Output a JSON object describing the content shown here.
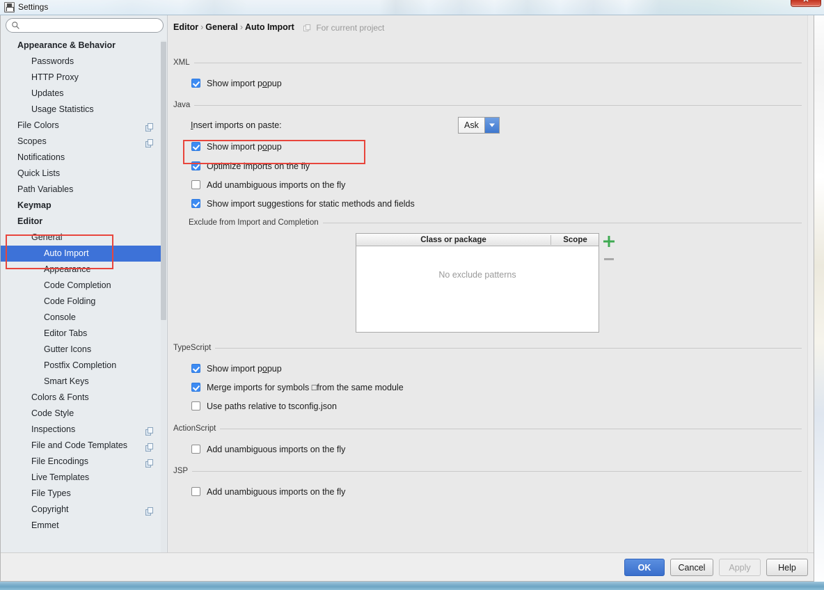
{
  "window": {
    "title": "Settings",
    "icon": "save-disk-icon",
    "close_label": "✕"
  },
  "sidebar": {
    "search": {
      "value": "",
      "placeholder": "",
      "icon": "search-icon"
    },
    "items": [
      {
        "label": "Appearance & Behavior",
        "level": 0,
        "bold": true,
        "arrow": "none",
        "copy": false,
        "selected": false
      },
      {
        "label": "Passwords",
        "level": 1,
        "bold": false,
        "arrow": "none",
        "copy": false,
        "selected": false
      },
      {
        "label": "HTTP Proxy",
        "level": 1,
        "bold": false,
        "arrow": "none",
        "copy": false,
        "selected": false
      },
      {
        "label": "Updates",
        "level": 1,
        "bold": false,
        "arrow": "none",
        "copy": false,
        "selected": false
      },
      {
        "label": "Usage Statistics",
        "level": 1,
        "bold": false,
        "arrow": "none",
        "copy": false,
        "selected": false
      },
      {
        "label": "File Colors",
        "level": 0,
        "bold": false,
        "arrow": "none",
        "copy": true,
        "selected": false
      },
      {
        "label": "Scopes",
        "level": 0,
        "bold": false,
        "arrow": "none",
        "copy": true,
        "selected": false
      },
      {
        "label": "Notifications",
        "level": 0,
        "bold": false,
        "arrow": "none",
        "copy": false,
        "selected": false
      },
      {
        "label": "Quick Lists",
        "level": 0,
        "bold": false,
        "arrow": "none",
        "copy": false,
        "selected": false
      },
      {
        "label": "Path Variables",
        "level": 0,
        "bold": false,
        "arrow": "none",
        "copy": false,
        "selected": false
      },
      {
        "label": "Keymap",
        "level": 0,
        "bold": true,
        "arrow": "none",
        "copy": false,
        "selected": false
      },
      {
        "label": "Editor",
        "level": 0,
        "bold": true,
        "arrow": "open",
        "copy": false,
        "selected": false
      },
      {
        "label": "General",
        "level": 1,
        "bold": false,
        "arrow": "open",
        "copy": false,
        "selected": false
      },
      {
        "label": "Auto Import",
        "level": 2,
        "bold": false,
        "arrow": "none",
        "copy": false,
        "selected": true
      },
      {
        "label": "Appearance",
        "level": 2,
        "bold": false,
        "arrow": "none",
        "copy": false,
        "selected": false
      },
      {
        "label": "Code Completion",
        "level": 2,
        "bold": false,
        "arrow": "none",
        "copy": false,
        "selected": false
      },
      {
        "label": "Code Folding",
        "level": 2,
        "bold": false,
        "arrow": "none",
        "copy": false,
        "selected": false
      },
      {
        "label": "Console",
        "level": 2,
        "bold": false,
        "arrow": "none",
        "copy": false,
        "selected": false
      },
      {
        "label": "Editor Tabs",
        "level": 2,
        "bold": false,
        "arrow": "none",
        "copy": false,
        "selected": false
      },
      {
        "label": "Gutter Icons",
        "level": 2,
        "bold": false,
        "arrow": "none",
        "copy": false,
        "selected": false
      },
      {
        "label": "Postfix Completion",
        "level": 2,
        "bold": false,
        "arrow": "none",
        "copy": false,
        "selected": false
      },
      {
        "label": "Smart Keys",
        "level": 2,
        "bold": false,
        "arrow": "none",
        "copy": false,
        "selected": false
      },
      {
        "label": "Colors & Fonts",
        "level": 1,
        "bold": false,
        "arrow": "closed",
        "copy": false,
        "selected": false
      },
      {
        "label": "Code Style",
        "level": 1,
        "bold": false,
        "arrow": "closed",
        "copy": false,
        "selected": false
      },
      {
        "label": "Inspections",
        "level": 1,
        "bold": false,
        "arrow": "none",
        "copy": true,
        "selected": false
      },
      {
        "label": "File and Code Templates",
        "level": 1,
        "bold": false,
        "arrow": "none",
        "copy": true,
        "selected": false
      },
      {
        "label": "File Encodings",
        "level": 1,
        "bold": false,
        "arrow": "none",
        "copy": true,
        "selected": false
      },
      {
        "label": "Live Templates",
        "level": 1,
        "bold": false,
        "arrow": "none",
        "copy": false,
        "selected": false
      },
      {
        "label": "File Types",
        "level": 1,
        "bold": false,
        "arrow": "none",
        "copy": false,
        "selected": false
      },
      {
        "label": "Copyright",
        "level": 1,
        "bold": false,
        "arrow": "closed",
        "copy": true,
        "selected": false
      },
      {
        "label": "Emmet",
        "level": 1,
        "bold": false,
        "arrow": "closed",
        "copy": false,
        "selected": false
      }
    ]
  },
  "main": {
    "breadcrumb": {
      "parts": [
        "Editor",
        "General",
        "Auto Import"
      ],
      "separator": "›"
    },
    "crumb_note": {
      "text": "For current project",
      "icon": "copy-scope-icon"
    },
    "sections": {
      "xml": {
        "title": "XML",
        "options": [
          {
            "label": "Show import popup",
            "checked": true,
            "underline_index": 13
          }
        ]
      },
      "java": {
        "title": "Java",
        "combo": {
          "label": "Insert imports on paste:",
          "value": "Ask",
          "underline_index": 0
        },
        "options": [
          {
            "label": "Show import popup",
            "checked": true
          },
          {
            "label": "Optimize imports on the fly",
            "checked": true,
            "highlighted": true
          },
          {
            "label": "Add unambiguous imports on the fly",
            "checked": false
          },
          {
            "label": "Show import suggestions for static methods and fields",
            "checked": true
          }
        ],
        "exclude": {
          "title": "Exclude from Import and Completion",
          "columns": [
            "Class or package",
            "Scope"
          ],
          "rows": [],
          "empty_text": "No exclude patterns",
          "add_label": "+",
          "remove_label": "−"
        }
      },
      "typescript": {
        "title": "TypeScript",
        "options": [
          {
            "label": "Show import popup",
            "checked": true
          },
          {
            "label": "Merge imports for symbols □from the same module",
            "checked": true
          },
          {
            "label": "Use paths relative to tsconfig.json",
            "checked": false
          }
        ]
      },
      "actionscript": {
        "title": "ActionScript",
        "options": [
          {
            "label": "Add unambiguous imports on the fly",
            "checked": false
          }
        ]
      },
      "jsp": {
        "title": "JSP",
        "options": [
          {
            "label": "Add unambiguous imports on the fly",
            "checked": false
          }
        ]
      }
    }
  },
  "footer": {
    "ok": "OK",
    "cancel": "Cancel",
    "apply": "Apply",
    "help": "Help"
  },
  "colors": {
    "selection": "#3d72d8",
    "checkbox_on": "#3d8bf2",
    "primary_button": "#3a6fcc",
    "annotation": "#e8453c",
    "add_icon": "#3faa52"
  }
}
